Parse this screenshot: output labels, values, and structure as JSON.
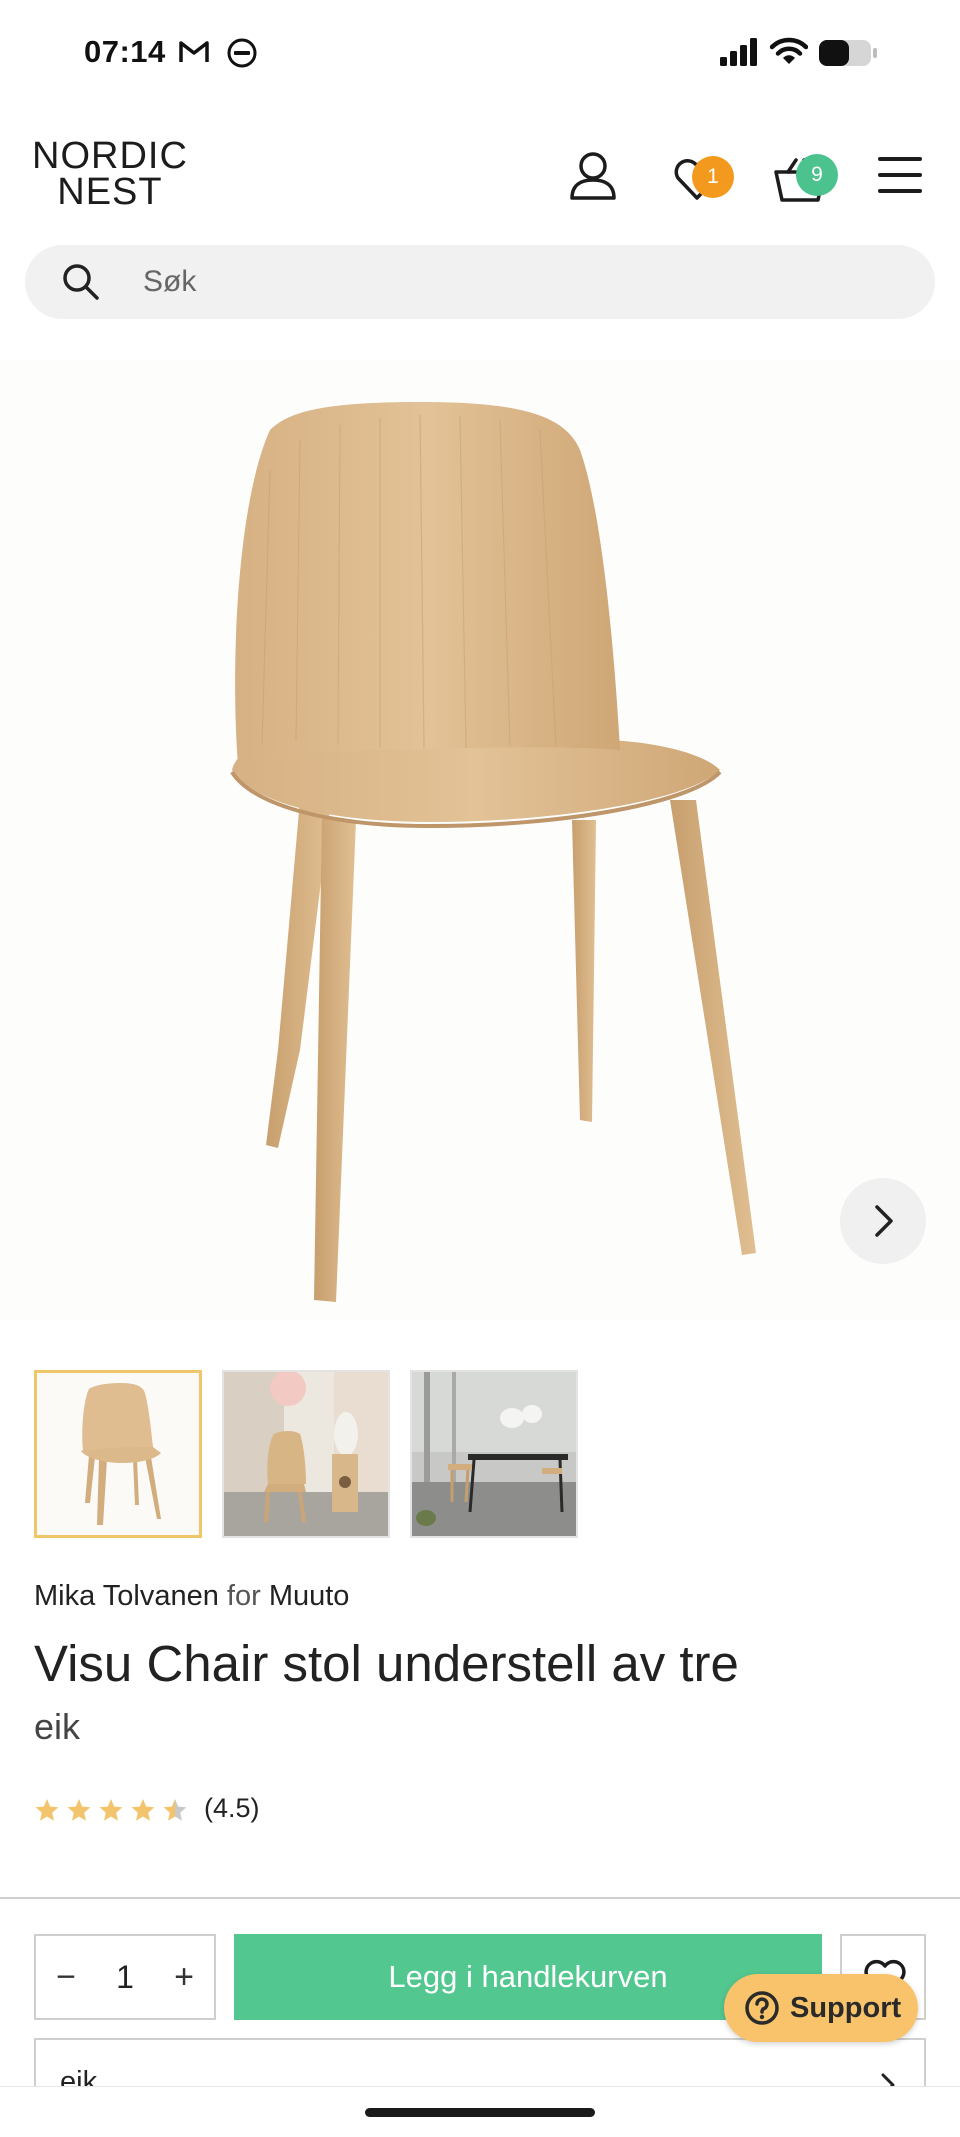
{
  "status_bar": {
    "time": "07:14",
    "icons": [
      "gmail-icon",
      "app-icon",
      "signal-icon",
      "wifi-icon",
      "battery-icon"
    ]
  },
  "header": {
    "logo_line1": "NORDIC",
    "logo_line2": "NEST",
    "wishlist_count": "1",
    "cart_count": "9",
    "icons": [
      "account-icon",
      "heart-icon",
      "basket-icon",
      "menu-icon"
    ],
    "colors": {
      "wishlist_badge": "#f39a1e",
      "cart_badge": "#4cc28f"
    }
  },
  "search": {
    "placeholder": "Søk"
  },
  "product": {
    "designer": "Mika Tolvanen",
    "for_word": "for",
    "brand": "Muuto",
    "title": "Visu Chair stol understell av tre",
    "variant": "eik",
    "rating_text": "(4.5)",
    "rating_value": 4.5,
    "rating_max": 5,
    "thumbnail_count": 3,
    "active_thumbnail": 1
  },
  "cart": {
    "quantity": "1",
    "minus_label": "−",
    "plus_label": "+",
    "add_label": "Legg i handlekurven",
    "add_color": "#52c790"
  },
  "support": {
    "label": "Support",
    "color": "#f8c36a"
  },
  "variant_selector": {
    "value": "eik"
  }
}
